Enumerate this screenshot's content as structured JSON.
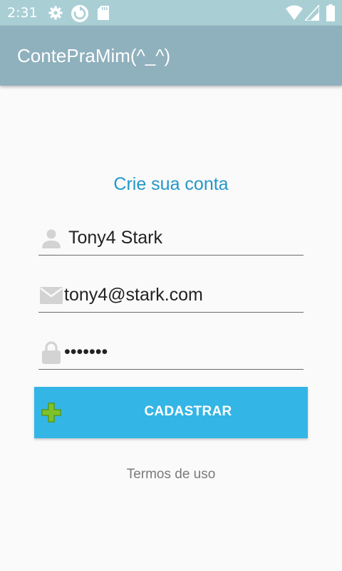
{
  "status_bar": {
    "time": "2:31",
    "icons": [
      "settings-icon",
      "sync-icon",
      "sd-card-icon",
      "wifi-icon",
      "signal-icon",
      "battery-icon"
    ]
  },
  "app_bar": {
    "title": "ContePraMim(^_^)"
  },
  "form": {
    "heading": "Crie sua conta",
    "name_value": "Tony4 Stark",
    "email_value": "tony4@stark.com",
    "password_value": "1234567",
    "submit_label": "CADASTRAR",
    "terms_link": "Termos de uso"
  },
  "colors": {
    "status_bar": "#a9cfd5",
    "app_bar": "#8fb0bd",
    "accent": "#2497c9",
    "button": "#33b5e5",
    "plus_icon": "#7dc22b"
  }
}
